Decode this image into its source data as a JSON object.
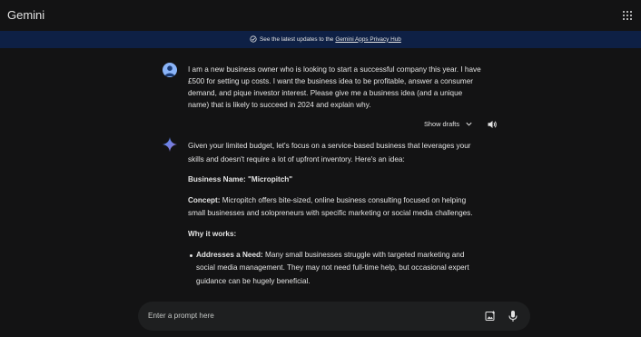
{
  "app": {
    "title": "Gemini"
  },
  "banner": {
    "text": "See the latest updates to the",
    "link": "Gemini Apps Privacy Hub"
  },
  "prompt": {
    "text": "I am a new business owner who is looking to start a successful company this year. I have £500 for setting up costs. I want the business idea to be profitable, answer a consumer demand, and pique investor interest. Please give me a business idea (and a unique name) that is likely to succeed in 2024 and explain why."
  },
  "drafts": {
    "label": "Show drafts"
  },
  "response": {
    "intro": "Given your limited budget, let's focus on a service-based business that leverages your skills and doesn't require a lot of upfront inventory. Here's an idea:",
    "name_label": "Business Name:",
    "name_value": "\"Micropitch\"",
    "concept_label": "Concept:",
    "concept_text": "Micropitch offers bite-sized, online business consulting focused on helping small businesses and solopreneurs with specific marketing or social media challenges.",
    "why_heading": "Why it works:",
    "bullets": [
      {
        "label": "Addresses a Need:",
        "text": "Many small businesses struggle with targeted marketing and social media management. They may not need full-time help, but occasional expert guidance can be hugely beneficial."
      }
    ]
  },
  "input": {
    "placeholder": "Enter a prompt here"
  },
  "colors": {
    "background": "#131314",
    "banner": "#0e2045",
    "input_bg": "#1e1f20",
    "text": "#e3e3e3",
    "accent": "#8ab4f8"
  }
}
